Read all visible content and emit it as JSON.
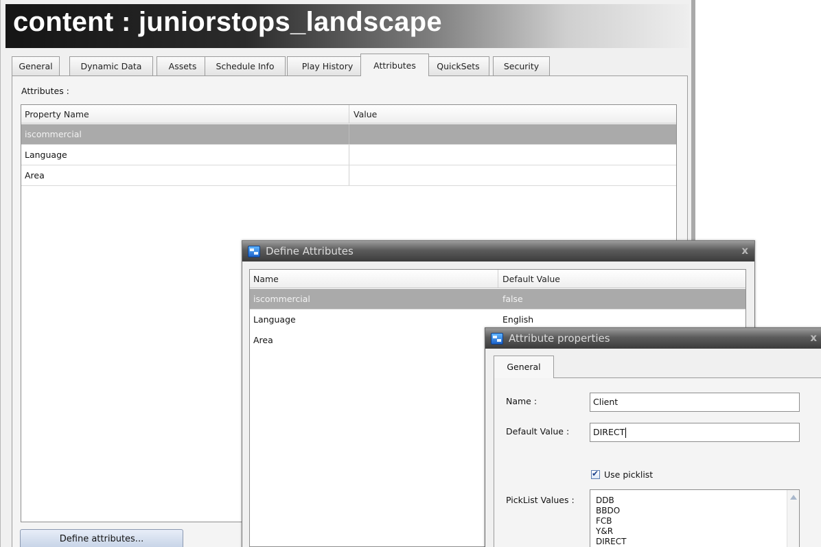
{
  "main": {
    "title": "content : juniorstops_landscape",
    "tabs": [
      "General",
      "Dynamic Data",
      "Assets",
      "Schedule Info",
      "Play History",
      "Attributes",
      "QuickSets",
      "Security"
    ],
    "active_tab": "Attributes",
    "attributes_label": "Attributes :",
    "table": {
      "columns": [
        "Property Name",
        "Value"
      ],
      "rows": [
        {
          "name": "iscommercial",
          "value": "",
          "selected": true
        },
        {
          "name": "Language",
          "value": ""
        },
        {
          "name": "Area",
          "value": ""
        }
      ]
    },
    "define_button_label": "Define attributes..."
  },
  "define_dialog": {
    "title": "Define Attributes",
    "close": "x",
    "icon": "app-icon",
    "columns": [
      "Name",
      "Default Value"
    ],
    "rows": [
      {
        "name": "iscommercial",
        "value": "false",
        "selected": true
      },
      {
        "name": "Language",
        "value": "English"
      },
      {
        "name": "Area",
        "value": ""
      }
    ]
  },
  "properties_dialog": {
    "title": "Attribute properties",
    "close": "x",
    "tab": "General",
    "name_label": "Name :",
    "name_value": "Client",
    "default_label": "Default Value :",
    "default_value": "DIRECT",
    "use_picklist_label": "Use picklist",
    "use_picklist_checked": true,
    "picklist_label": "PickList Values :",
    "picklist_values": [
      "DDB",
      "BBDO",
      "FCB",
      "Y&R",
      "DIRECT"
    ]
  },
  "colors": {
    "selected_row": "#aaaaaa",
    "dialog_titlebar": "#3c3c3c",
    "button_blue": "#c4d2e6"
  }
}
